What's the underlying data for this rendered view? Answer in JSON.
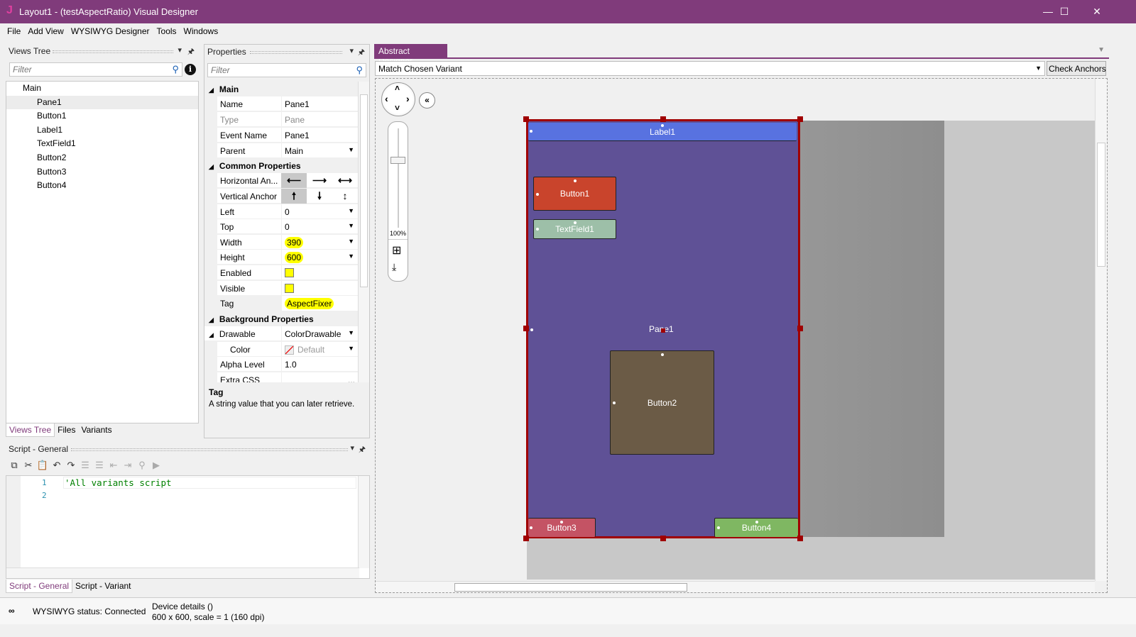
{
  "window": {
    "title": "Layout1 - (testAspectRatio) Visual Designer",
    "logo": "J",
    "minimize": "—",
    "maximize": "☐",
    "close": "✕"
  },
  "menu": [
    "File",
    "Add View",
    "WYSIWYG Designer",
    "Tools",
    "Windows"
  ],
  "views_tree": {
    "title": "Views Tree",
    "filter_placeholder": "Filter",
    "items": [
      "Main",
      "Pane1",
      "Button1",
      "Label1",
      "TextField1",
      "Button2",
      "Button3",
      "Button4"
    ],
    "selected": "Pane1",
    "tabs": [
      "Views Tree",
      "Files",
      "Variants"
    ]
  },
  "properties": {
    "title": "Properties",
    "filter_placeholder": "Filter",
    "main_cat": "Main",
    "name_k": "Name",
    "name_v": "Pane1",
    "type_k": "Type",
    "type_v": "Pane",
    "event_k": "Event Name",
    "event_v": "Pane1",
    "parent_k": "Parent",
    "parent_v": "Main",
    "common_cat": "Common Properties",
    "hanchor_k": "Horizontal An...",
    "vanchor_k": "Vertical Anchor",
    "left_k": "Left",
    "left_v": "0",
    "top_k": "Top",
    "top_v": "0",
    "width_k": "Width",
    "width_v": "390",
    "height_k": "Height",
    "height_v": "600",
    "enabled_k": "Enabled",
    "enabled_v": false,
    "visible_k": "Visible",
    "visible_v": false,
    "tag_k": "Tag",
    "tag_v": "AspectFixer",
    "bg_cat": "Background Properties",
    "drawable_k": "Drawable",
    "drawable_v": "ColorDrawable",
    "color_k": "Color",
    "color_v": "Default",
    "alpha_k": "Alpha Level",
    "alpha_v": "1.0",
    "css_k": "Extra CSS",
    "css_v": "...",
    "desc_title": "Tag",
    "desc_text": "A string value that you can later retrieve.",
    "highlight_color": "#ffff00"
  },
  "script": {
    "title": "Script - General",
    "lines": [
      "1",
      "2"
    ],
    "code": "'All variants script",
    "tabs": [
      "Script - General",
      "Script - Variant"
    ]
  },
  "designer": {
    "tab": "Abstract Designer",
    "variant": "Match Chosen Variant",
    "check_anchors": "Check Anchors",
    "zoom": "100%",
    "views": {
      "pane": "Pane1",
      "label1": "Label1",
      "button1": "Button1",
      "textfield1": "TextField1",
      "button2": "Button2",
      "button3": "Button3",
      "button4": "Button4"
    },
    "colors": {
      "pane": "#5f5196",
      "label1": "#5872e0",
      "button1": "#c9442c",
      "textfield1": "#9dbfa8",
      "button2": "#6b5b46",
      "button3": "#c45364",
      "button4": "#7fb762",
      "selection": "#a00000"
    }
  },
  "status": {
    "wysiwyg": "WYSIWYG status: Connected",
    "device_title": "Device details ()",
    "device_info": "600 x 600, scale = 1 (160 dpi)"
  }
}
